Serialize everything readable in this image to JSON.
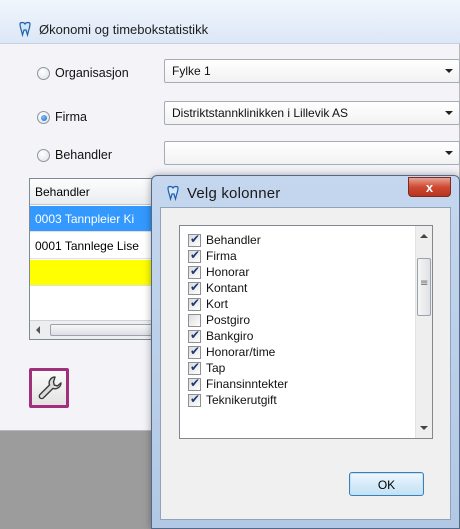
{
  "main_window": {
    "title": "Økonomi og timebokstatistikk",
    "title_icon": "tooth-icon",
    "filters": [
      {
        "label": "Organisasjon",
        "selected": false,
        "value": "Fylke 1"
      },
      {
        "label": "Firma",
        "selected": true,
        "value": "Distriktstannklinikken i Lillevik AS"
      },
      {
        "label": "Behandler",
        "selected": false,
        "value": ""
      }
    ],
    "grid": {
      "header": "Behandler",
      "rows": [
        "0003 Tannpleier Ki",
        "0001 Tannlege Lise"
      ]
    },
    "tool_button_icon": "wrench-icon"
  },
  "dialog": {
    "title": "Velg kolonner",
    "close_label": "x",
    "columns": [
      {
        "label": "Behandler",
        "checked": true
      },
      {
        "label": "Firma",
        "checked": true
      },
      {
        "label": "Honorar",
        "checked": true
      },
      {
        "label": "Kontant",
        "checked": true
      },
      {
        "label": "Kort",
        "checked": true
      },
      {
        "label": "Postgiro",
        "checked": false
      },
      {
        "label": "Bankgiro",
        "checked": true
      },
      {
        "label": "Honorar/time",
        "checked": true
      },
      {
        "label": "Tap",
        "checked": true
      },
      {
        "label": "Finansinntekter",
        "checked": true
      },
      {
        "label": "Teknikerutgift",
        "checked": true
      }
    ],
    "ok_label": "OK"
  },
  "colors": {
    "selection": "#3399ff",
    "highlight_row": "#ffff00",
    "tool_button_border": "#a0307a"
  }
}
